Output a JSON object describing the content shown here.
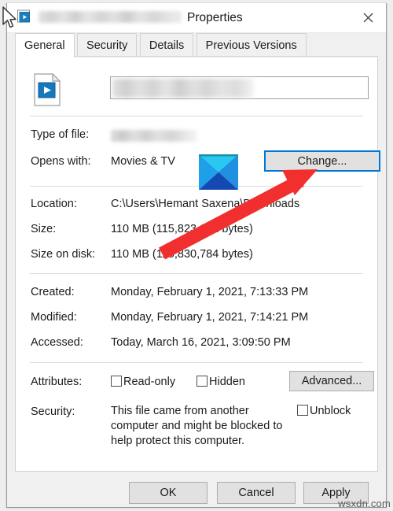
{
  "window": {
    "title_suffix": "Properties",
    "title_redacted": true,
    "icon": "video-file-icon",
    "close_label": "✕"
  },
  "tabs": [
    {
      "label": "General",
      "active": true
    },
    {
      "label": "Security",
      "active": false
    },
    {
      "label": "Details",
      "active": false
    },
    {
      "label": "Previous Versions",
      "active": false
    }
  ],
  "file": {
    "name_value": "",
    "name_redacted": true
  },
  "rows": [
    {
      "label": "Type of file:",
      "value": "",
      "redacted": true
    },
    {
      "label": "Opens with:",
      "value": "Movies & TV",
      "redacted": false
    },
    {
      "label": "Location:",
      "value": "C:\\Users\\Hemant Saxena\\Downloads",
      "redacted": false
    },
    {
      "label": "Size:",
      "value": "110 MB (115,823,022 bytes)",
      "redacted": false
    },
    {
      "label": "Size on disk:",
      "value": "110 MB (115,830,784 bytes)",
      "redacted": false
    },
    {
      "label": "Created:",
      "value": "Monday, February 1, 2021, 7:13:33 PM",
      "redacted": false
    },
    {
      "label": "Modified:",
      "value": "Monday, February 1, 2021, 7:14:21 PM",
      "redacted": false
    },
    {
      "label": "Accessed:",
      "value": "Today, March 16, 2021, 3:09:50 PM",
      "redacted": false
    }
  ],
  "buttons": {
    "change": "Change...",
    "advanced": "Advanced...",
    "ok": "OK",
    "cancel": "Cancel",
    "apply": "Apply"
  },
  "attributes": {
    "label": "Attributes:",
    "read_only": {
      "label": "Read-only",
      "checked": false
    },
    "hidden": {
      "label": "Hidden",
      "checked": false
    }
  },
  "security": {
    "label": "Security:",
    "message": "This file came from another computer and might be blocked to help protect this computer.",
    "unblock": {
      "label": "Unblock",
      "checked": false
    }
  },
  "annotations": {
    "arrow_color": "#f22f2f",
    "focus_color": "#0078d7",
    "marker": "blue-x-square",
    "cursor": "mouse-pointer"
  },
  "watermark": {
    "text": "wsxdn.com"
  }
}
